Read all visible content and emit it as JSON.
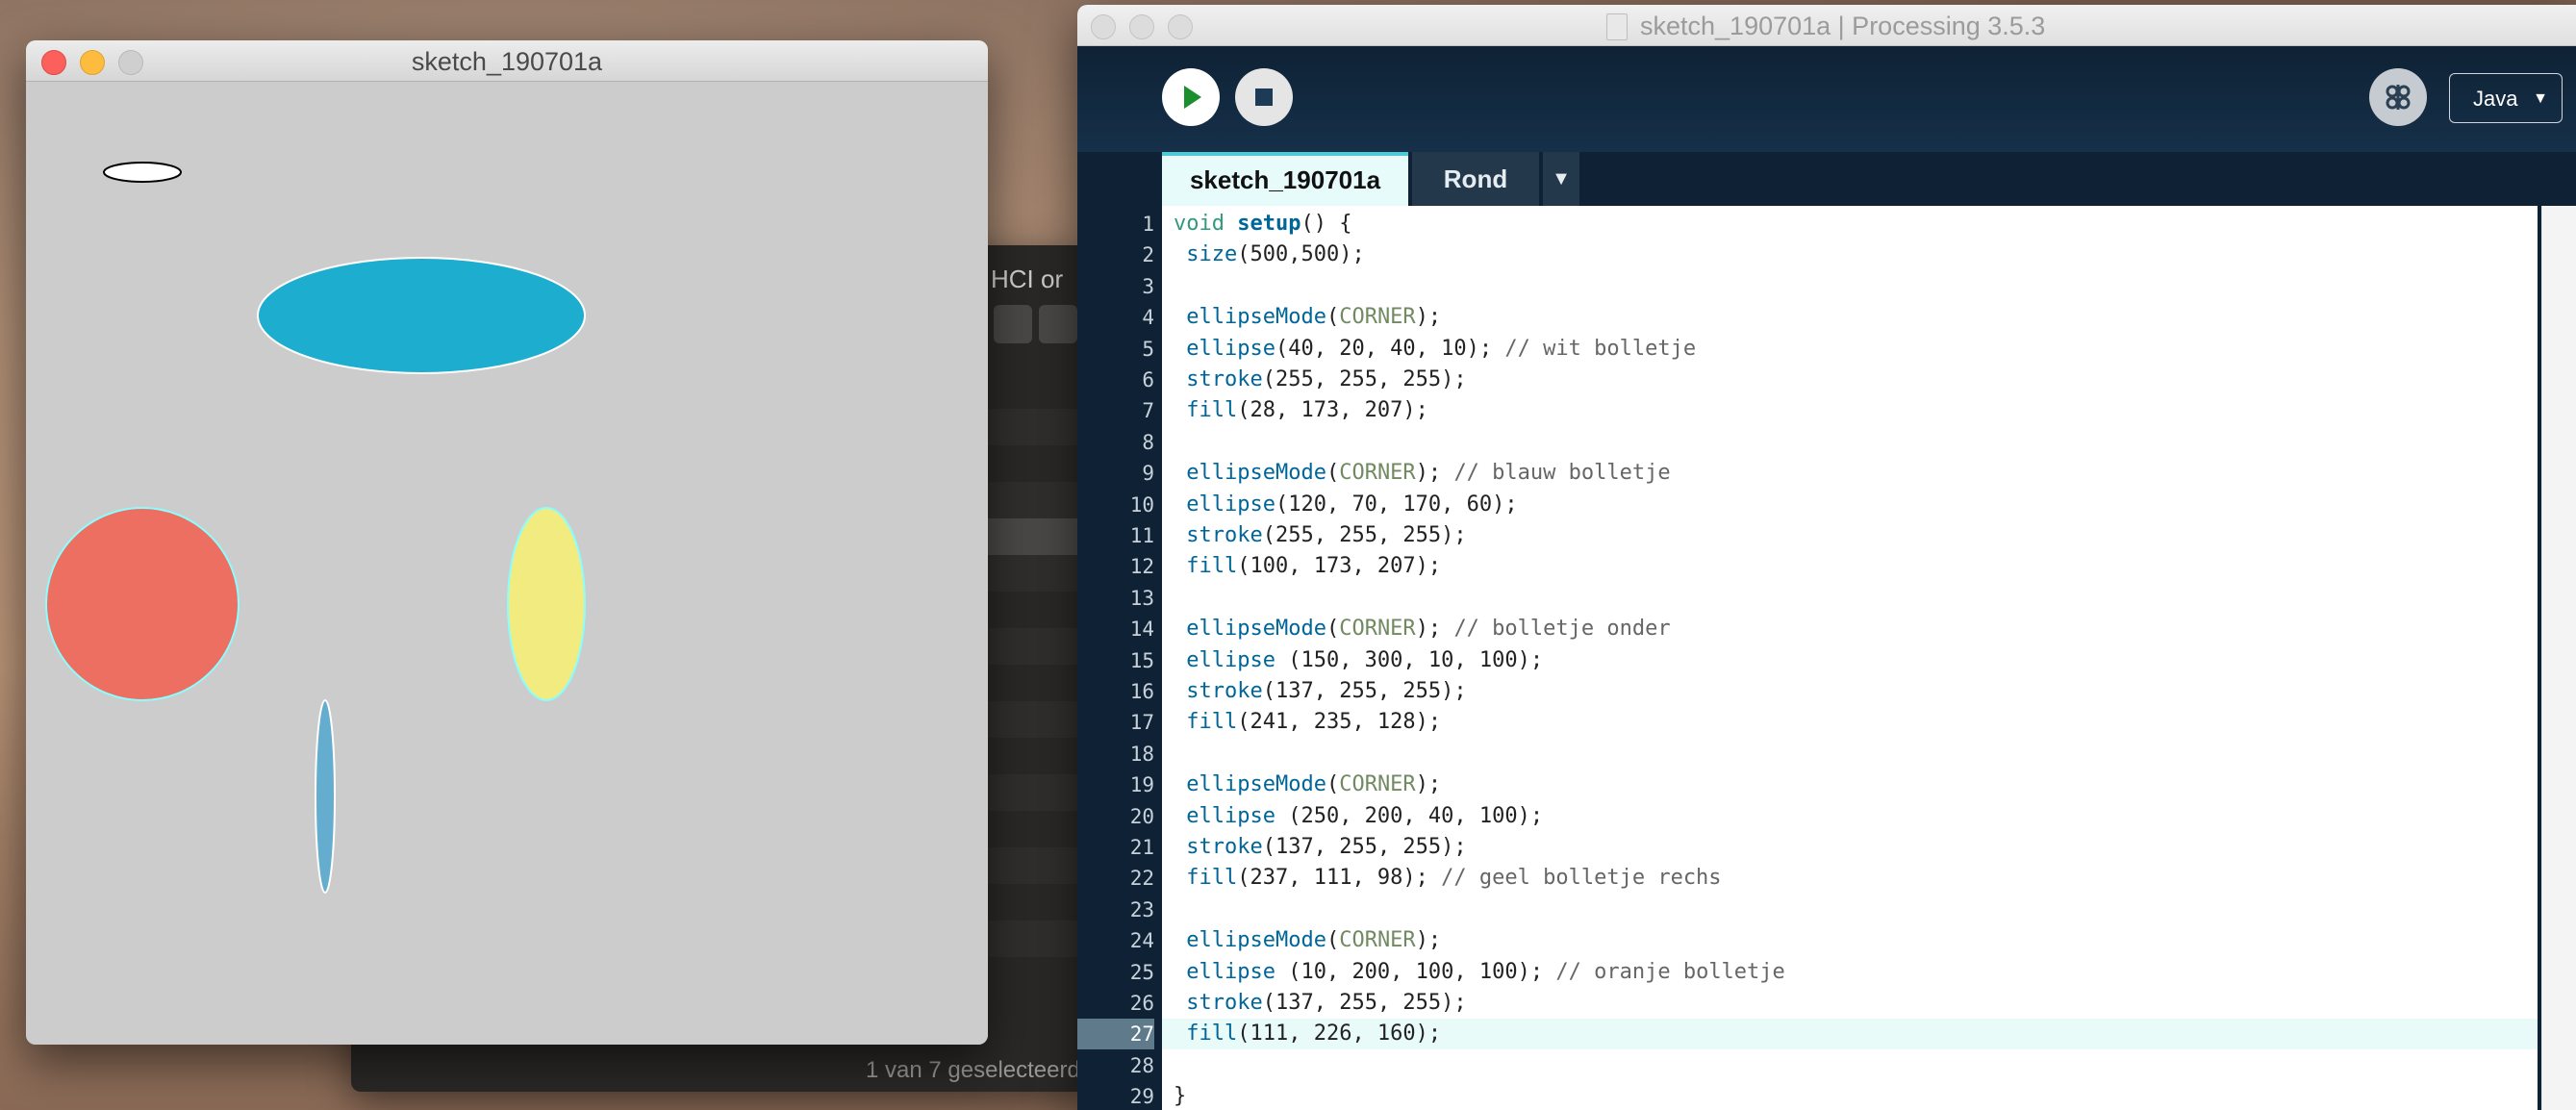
{
  "background_window": {
    "title": "HCI or",
    "status": "1 van 7 geselecteerd"
  },
  "sketch_window": {
    "title": "sketch_190701a",
    "canvas_bg": "#cccccc",
    "shapes": [
      {
        "name": "white-ellipse",
        "fill": "#ffffff",
        "stroke": "#000000"
      },
      {
        "name": "blue-ellipse",
        "fill": "#1cadcf",
        "stroke": "#ffffff"
      },
      {
        "name": "thin-blue-ellipse",
        "fill": "#64adcf",
        "stroke": "#ffffff"
      },
      {
        "name": "yellow-ellipse",
        "fill": "#f1eb80",
        "stroke": "#89ffff"
      },
      {
        "name": "red-circle",
        "fill": "#ed6f62",
        "stroke": "#89ffff"
      }
    ]
  },
  "ide": {
    "title": "sketch_190701a | Processing 3.5.3",
    "mode_label": "Java",
    "mode_caret": "▼",
    "tab_active": "sketch_190701a",
    "tab_second": "Rond",
    "tab_menu": "▼",
    "highlighted_line": 27,
    "lines": [
      {
        "n": "1",
        "segs": [
          [
            "kw",
            "void "
          ],
          [
            "fnb",
            "setup"
          ],
          [
            "",
            "() {"
          ]
        ]
      },
      {
        "n": "2",
        "segs": [
          [
            "",
            ""
          ],
          [
            "fn",
            "size"
          ],
          [
            "",
            "(500,500);"
          ]
        ]
      },
      {
        "n": "3",
        "segs": []
      },
      {
        "n": "4",
        "segs": [
          [
            "fn",
            "ellipseMode"
          ],
          [
            "",
            "("
          ],
          [
            "const",
            "CORNER"
          ],
          [
            "",
            ");"
          ]
        ]
      },
      {
        "n": "5",
        "segs": [
          [
            "fn",
            "ellipse"
          ],
          [
            "",
            "(40, 20, 40, 10); "
          ],
          [
            "cm",
            "// wit bolletje"
          ]
        ]
      },
      {
        "n": "6",
        "segs": [
          [
            "fn",
            "stroke"
          ],
          [
            "",
            "(255, 255, 255);"
          ]
        ]
      },
      {
        "n": "7",
        "segs": [
          [
            "fn",
            "fill"
          ],
          [
            "",
            "(28, 173, 207);"
          ]
        ]
      },
      {
        "n": "8",
        "segs": []
      },
      {
        "n": "9",
        "segs": [
          [
            "fn",
            "ellipseMode"
          ],
          [
            "",
            "("
          ],
          [
            "const",
            "CORNER"
          ],
          [
            "",
            "); "
          ],
          [
            "cm",
            "// blauw bolletje"
          ]
        ]
      },
      {
        "n": "10",
        "segs": [
          [
            "fn",
            "ellipse"
          ],
          [
            "",
            "(120, 70, 170, 60);"
          ]
        ]
      },
      {
        "n": "11",
        "segs": [
          [
            "fn",
            "stroke"
          ],
          [
            "",
            "(255, 255, 255);"
          ]
        ]
      },
      {
        "n": "12",
        "segs": [
          [
            "fn",
            "fill"
          ],
          [
            "",
            "(100, 173, 207);"
          ]
        ]
      },
      {
        "n": "13",
        "segs": []
      },
      {
        "n": "14",
        "segs": [
          [
            "fn",
            "ellipseMode"
          ],
          [
            "",
            "("
          ],
          [
            "const",
            "CORNER"
          ],
          [
            "",
            "); "
          ],
          [
            "cm",
            "// bolletje onder"
          ]
        ]
      },
      {
        "n": "15",
        "segs": [
          [
            "fn",
            "ellipse"
          ],
          [
            "",
            " (150, 300, 10, 100);"
          ]
        ]
      },
      {
        "n": "16",
        "segs": [
          [
            "fn",
            "stroke"
          ],
          [
            "",
            "(137, 255, 255);"
          ]
        ]
      },
      {
        "n": "17",
        "segs": [
          [
            "fn",
            "fill"
          ],
          [
            "",
            "(241, 235, 128);"
          ]
        ]
      },
      {
        "n": "18",
        "segs": []
      },
      {
        "n": "19",
        "segs": [
          [
            "fn",
            "ellipseMode"
          ],
          [
            "",
            "("
          ],
          [
            "const",
            "CORNER"
          ],
          [
            "",
            ");"
          ]
        ]
      },
      {
        "n": "20",
        "segs": [
          [
            "fn",
            "ellipse"
          ],
          [
            "",
            " (250, 200, 40, 100);"
          ]
        ]
      },
      {
        "n": "21",
        "segs": [
          [
            "fn",
            "stroke"
          ],
          [
            "",
            "(137, 255, 255);"
          ]
        ]
      },
      {
        "n": "22",
        "segs": [
          [
            "fn",
            "fill"
          ],
          [
            "",
            "(237, 111, 98); "
          ],
          [
            "cm",
            "// geel bolletje rechs"
          ]
        ]
      },
      {
        "n": "23",
        "segs": []
      },
      {
        "n": "24",
        "segs": [
          [
            "fn",
            "ellipseMode"
          ],
          [
            "",
            "("
          ],
          [
            "const",
            "CORNER"
          ],
          [
            "",
            ");"
          ]
        ]
      },
      {
        "n": "25",
        "segs": [
          [
            "fn",
            "ellipse"
          ],
          [
            "",
            " (10, 200, 100, 100); "
          ],
          [
            "cm",
            "// oranje bolletje"
          ]
        ]
      },
      {
        "n": "26",
        "segs": [
          [
            "fn",
            "stroke"
          ],
          [
            "",
            "(137, 255, 255);"
          ]
        ]
      },
      {
        "n": "27",
        "segs": [
          [
            "fn",
            "fill"
          ],
          [
            "",
            "(111, 226, 160);"
          ]
        ]
      },
      {
        "n": "28",
        "segs": []
      },
      {
        "n": "29",
        "segs": [
          [
            "",
            "}"
          ]
        ]
      }
    ]
  }
}
